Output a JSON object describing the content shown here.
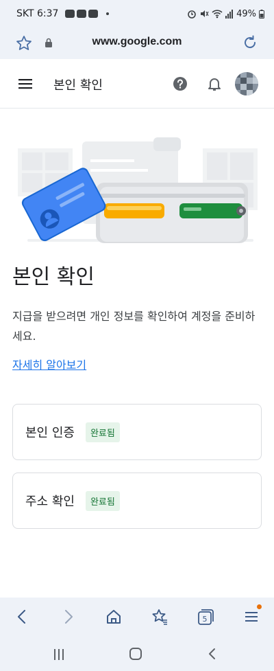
{
  "status_bar": {
    "carrier_time": "SKT 6:37",
    "battery": "49%"
  },
  "browser": {
    "url": "www.google.com"
  },
  "header": {
    "title": "본인 확인"
  },
  "main": {
    "title": "본인 확인",
    "description": "지급을 받으려면 개인 정보를 확인하여 계정을 준비하세요.",
    "learn_more": "자세히 알아보기",
    "cards": [
      {
        "label": "본인 인증",
        "status": "완료됨"
      },
      {
        "label": "주소 확인",
        "status": "완료됨"
      }
    ]
  },
  "bottom_toolbar": {
    "tab_count": "5"
  },
  "colors": {
    "accent": "#1a73e8",
    "status_done_bg": "#e6f4ea",
    "status_done_text": "#137333",
    "browser_chrome": "#eef2f8"
  },
  "icons": {
    "status_bar": [
      "message-icon",
      "chat-icon",
      "pay-icon",
      "alarm-icon",
      "mute-icon",
      "wifi-icon",
      "signal-icon",
      "battery-icon"
    ],
    "browser": [
      "star-icon",
      "lock-icon",
      "reload-icon"
    ],
    "header": [
      "menu-icon",
      "help-icon",
      "bell-icon",
      "avatar"
    ],
    "toolbar": [
      "back-icon",
      "forward-icon",
      "home-icon",
      "bookmarks-icon",
      "tabs-icon",
      "menu-icon"
    ],
    "nav": [
      "recents-icon",
      "home-circle-icon",
      "back-chevron-icon"
    ]
  }
}
